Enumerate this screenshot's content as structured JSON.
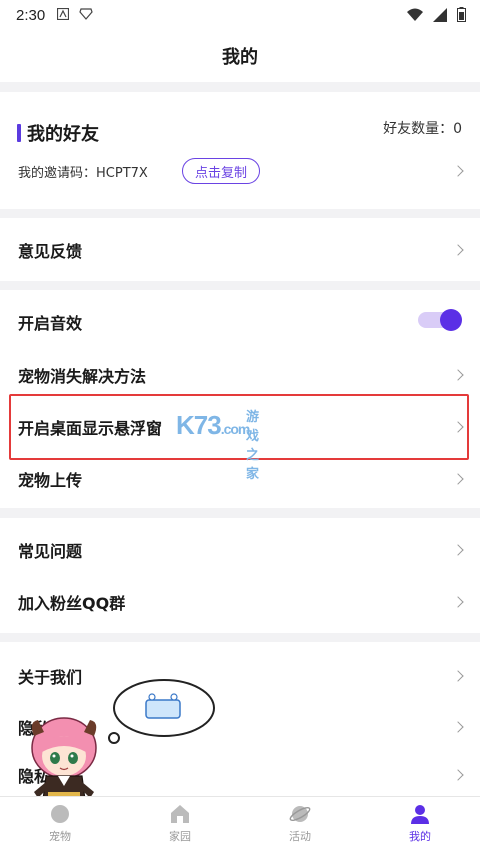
{
  "status_bar": {
    "time": "2:30"
  },
  "header": {
    "title": "我的"
  },
  "friends": {
    "title": "我的好友",
    "count_label": "好友数量：0",
    "invite_label": "我的邀请码：HCPT7X",
    "copy_button": "点击复制"
  },
  "menu": {
    "feedback": "意见反馈",
    "sound": "开启音效",
    "sound_enabled": true,
    "pet_missing": "宠物消失解决方法",
    "floating_window": "开启桌面显示悬浮窗",
    "pet_upload": "宠物上传",
    "faq": "常见问题",
    "qq_group": "加入粉丝QQ群",
    "about": "关于我们",
    "privacy1": "隐私政策",
    "privacy2": "隐私"
  },
  "watermark": {
    "main": "K73",
    "sub": ".com",
    "side": "游戏之家"
  },
  "tabbar": {
    "items": [
      {
        "label": "宠物"
      },
      {
        "label": "家园"
      },
      {
        "label": "活动"
      },
      {
        "label": "我的"
      }
    ],
    "active_color": "#5b2fe6"
  },
  "colors": {
    "accent": "#5b2fe6",
    "highlight": "#e43a3a"
  }
}
